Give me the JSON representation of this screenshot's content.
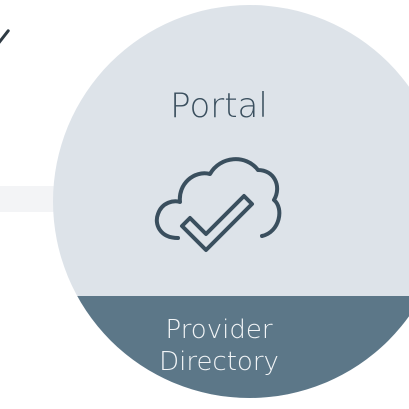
{
  "widget": {
    "title": "Portal",
    "band_line1": "Provider",
    "band_line2": "Directory",
    "icon": "cloud-check-icon"
  },
  "colors": {
    "circle_fill": "#dde3e9",
    "band_fill": "#5c7788",
    "title_text": "#3a4f5e",
    "band_text": "#f2f5f7",
    "connector": "#2f3b44"
  }
}
